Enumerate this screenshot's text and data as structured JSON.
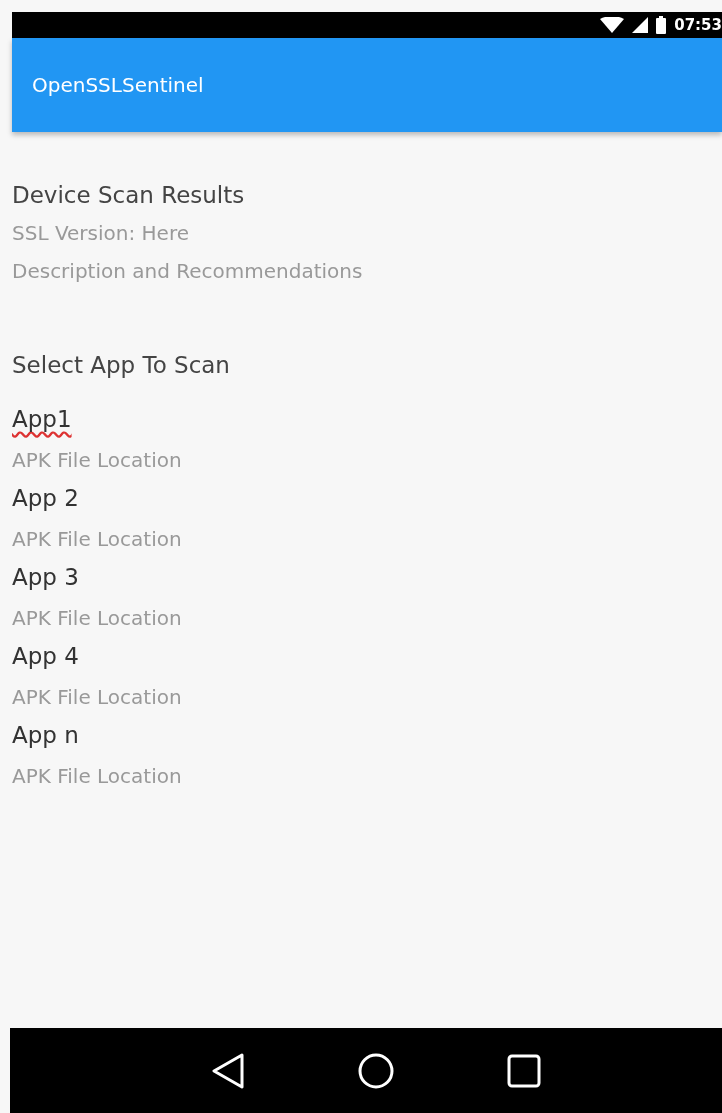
{
  "status_bar": {
    "time": "07:53"
  },
  "app_bar": {
    "title": "OpenSSLSentinel"
  },
  "results": {
    "heading": "Device Scan Results",
    "lines": [
      "SSL Version: Here",
      "Description and Recommendations"
    ]
  },
  "app_list": {
    "heading": "Select App To Scan",
    "apps": [
      {
        "name": "App1",
        "path": "APK File Location",
        "misspelled": true
      },
      {
        "name": "App 2",
        "path": "APK File Location",
        "misspelled": false
      },
      {
        "name": "App 3",
        "path": "APK File Location",
        "misspelled": false
      },
      {
        "name": "App 4",
        "path": "APK File Location",
        "misspelled": false
      },
      {
        "name": "App n",
        "path": "APK File Location",
        "misspelled": false
      }
    ]
  }
}
